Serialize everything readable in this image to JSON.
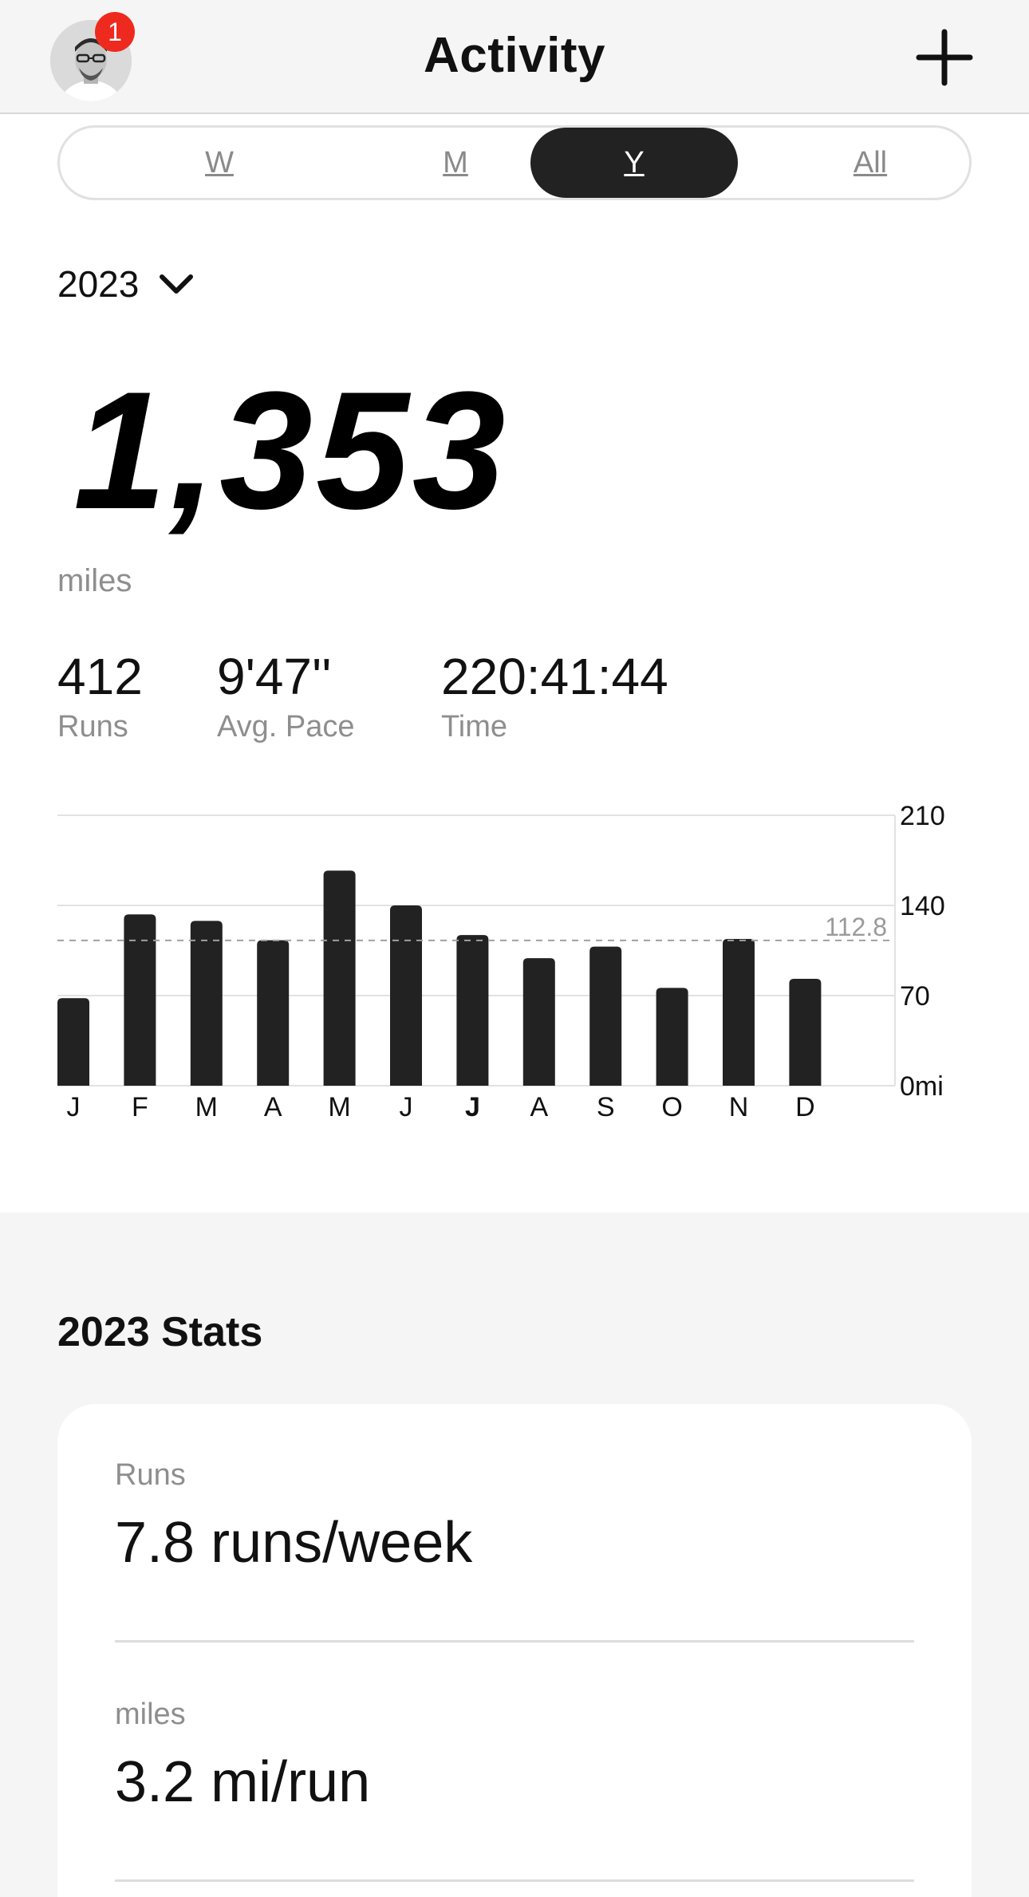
{
  "header": {
    "title": "Activity",
    "notification_count": "1",
    "avatar_icon": "profile-avatar",
    "add_icon": "plus-icon"
  },
  "range_tabs": [
    {
      "label": "W",
      "active": false
    },
    {
      "label": "M",
      "active": false
    },
    {
      "label": "Y",
      "active": true
    },
    {
      "label": "All",
      "active": false
    }
  ],
  "year_select": {
    "value": "2023",
    "icon": "chevron-down-icon"
  },
  "summary": {
    "total": "1,353",
    "unit": "miles",
    "stats": [
      {
        "value": "412",
        "label": "Runs"
      },
      {
        "value": "9'47''",
        "label": "Avg. Pace"
      },
      {
        "value": "220:41:44",
        "label": "Time"
      }
    ]
  },
  "chart_data": {
    "type": "bar",
    "categories": [
      "J",
      "F",
      "M",
      "A",
      "M",
      "J",
      "J",
      "A",
      "S",
      "O",
      "N",
      "D"
    ],
    "values": [
      68,
      133,
      128,
      113,
      167,
      140,
      117,
      99,
      108,
      76,
      114,
      83
    ],
    "highlighted_category_index": 6,
    "average": 112.8,
    "average_label": "112.8",
    "y_ticks": [
      "210",
      "140",
      "70",
      "0mi"
    ],
    "ylim": [
      0,
      210
    ],
    "bar_color": "#222222",
    "grid": true
  },
  "stats_section": {
    "title": "2023 Stats",
    "items": [
      {
        "label": "Runs",
        "value": "7.8 runs/week"
      },
      {
        "label": "miles",
        "value": "3.2 mi/run"
      }
    ]
  },
  "colors": {
    "accent": "#222222",
    "badge": "#ee2a1e",
    "muted_text": "#8e8e8e",
    "section_bg": "#f5f5f5"
  }
}
